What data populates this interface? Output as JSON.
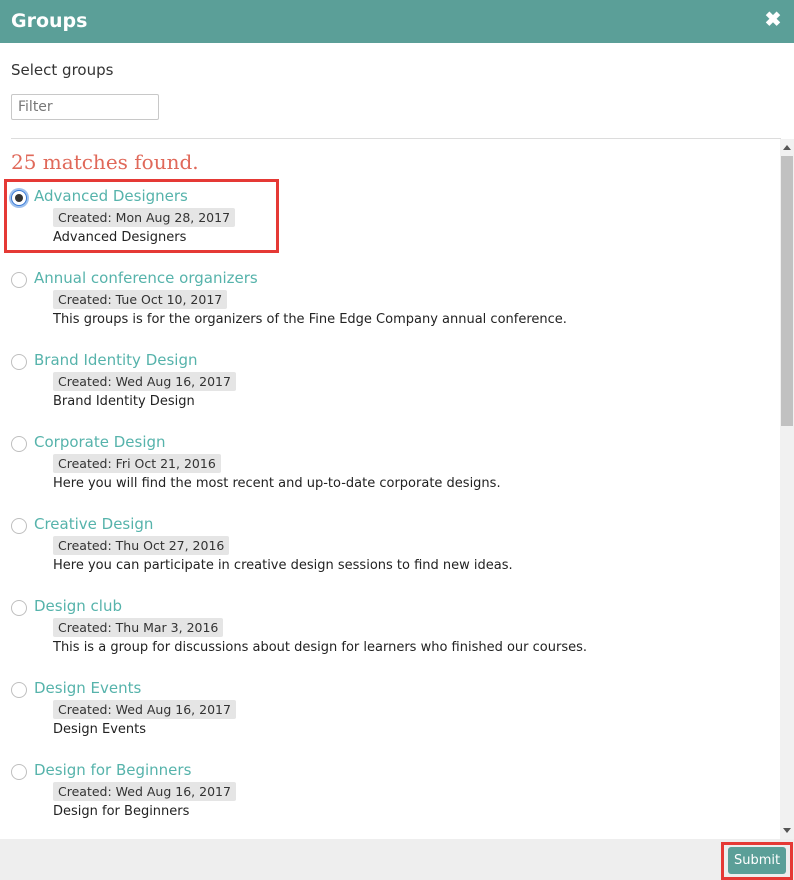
{
  "dialog": {
    "title": "Groups",
    "close_icon": "close-icon"
  },
  "subtitle": "Select groups",
  "filter": {
    "placeholder": "Filter",
    "value": ""
  },
  "matches_text": "25 matches found.",
  "groups": [
    {
      "name": "Advanced Designers",
      "created": "Created: Mon Aug 28, 2017",
      "description": "Advanced Designers",
      "selected": true
    },
    {
      "name": "Annual conference organizers",
      "created": "Created: Tue Oct 10, 2017",
      "description": "This groups is for the organizers of the Fine Edge Company annual conference.",
      "selected": false
    },
    {
      "name": "Brand Identity Design",
      "created": "Created: Wed Aug 16, 2017",
      "description": "Brand Identity Design",
      "selected": false
    },
    {
      "name": "Corporate Design",
      "created": "Created: Fri Oct 21, 2016",
      "description": "Here you will find the most recent and up-to-date corporate designs.",
      "selected": false
    },
    {
      "name": "Creative Design",
      "created": "Created: Thu Oct 27, 2016",
      "description": "Here you can participate in creative design sessions to find new ideas.",
      "selected": false
    },
    {
      "name": "Design club",
      "created": "Created: Thu Mar 3, 2016",
      "description": "This is a group for discussions about design for learners who finished our courses.",
      "selected": false
    },
    {
      "name": "Design Events",
      "created": "Created: Wed Aug 16, 2017",
      "description": "Design Events",
      "selected": false
    },
    {
      "name": "Design for Beginners",
      "created": "Created: Wed Aug 16, 2017",
      "description": "Design for Beginners",
      "selected": false
    }
  ],
  "footer": {
    "submit_label": "Submit"
  },
  "colors": {
    "header": "#5b9f98",
    "accent_link": "#56b3ab",
    "matches": "#e0695a",
    "highlight": "#e53935"
  }
}
